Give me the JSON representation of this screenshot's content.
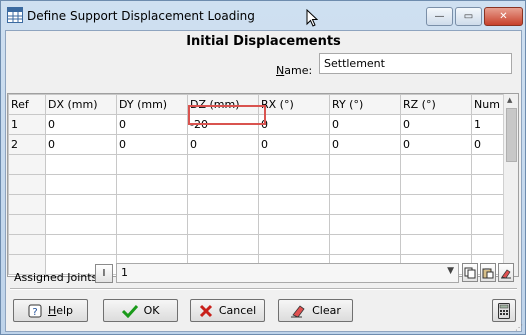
{
  "window": {
    "title": "Define Support Displacement Loading",
    "min_glyph": "—",
    "max_glyph": "▭",
    "close_glyph": "✕"
  },
  "form": {
    "heading": "Initial Displacements",
    "name_label_pre": "",
    "name_label_ul": "N",
    "name_label_post": "ame:",
    "name_value": "Settlement"
  },
  "table": {
    "columns": [
      "Ref",
      "DX (mm)",
      "DY (mm)",
      "DZ (mm)",
      "RX (°)",
      "RY (°)",
      "RZ (°)",
      "Num"
    ],
    "rows": [
      [
        "1",
        "0",
        "0",
        "-20",
        "0",
        "0",
        "0",
        "1"
      ],
      [
        "2",
        "0",
        "0",
        "0",
        "0",
        "0",
        "0",
        "0"
      ],
      [
        "",
        "",
        "",
        "",
        "",
        "",
        "",
        ""
      ],
      [
        "",
        "",
        "",
        "",
        "",
        "",
        "",
        ""
      ],
      [
        "",
        "",
        "",
        "",
        "",
        "",
        "",
        ""
      ],
      [
        "",
        "",
        "",
        "",
        "",
        "",
        "",
        ""
      ],
      [
        "",
        "",
        "",
        "",
        "",
        "",
        "",
        ""
      ],
      [
        "",
        "",
        "",
        "",
        "",
        "",
        "",
        ""
      ]
    ],
    "highlight_color": "#d9534f"
  },
  "assigned": {
    "label": "Assigned Joints:",
    "value": "1"
  },
  "buttons": {
    "help_pre": "",
    "help_ul": "H",
    "help_post": "elp",
    "ok": "OK",
    "cancel": "Cancel",
    "clear": "Clear"
  },
  "icons": {
    "app": "app-grid-icon",
    "help": "help-icon",
    "ok": "green-check-icon",
    "cancel": "red-x-icon",
    "clear": "eraser-icon",
    "calculator": "calculator-icon"
  }
}
